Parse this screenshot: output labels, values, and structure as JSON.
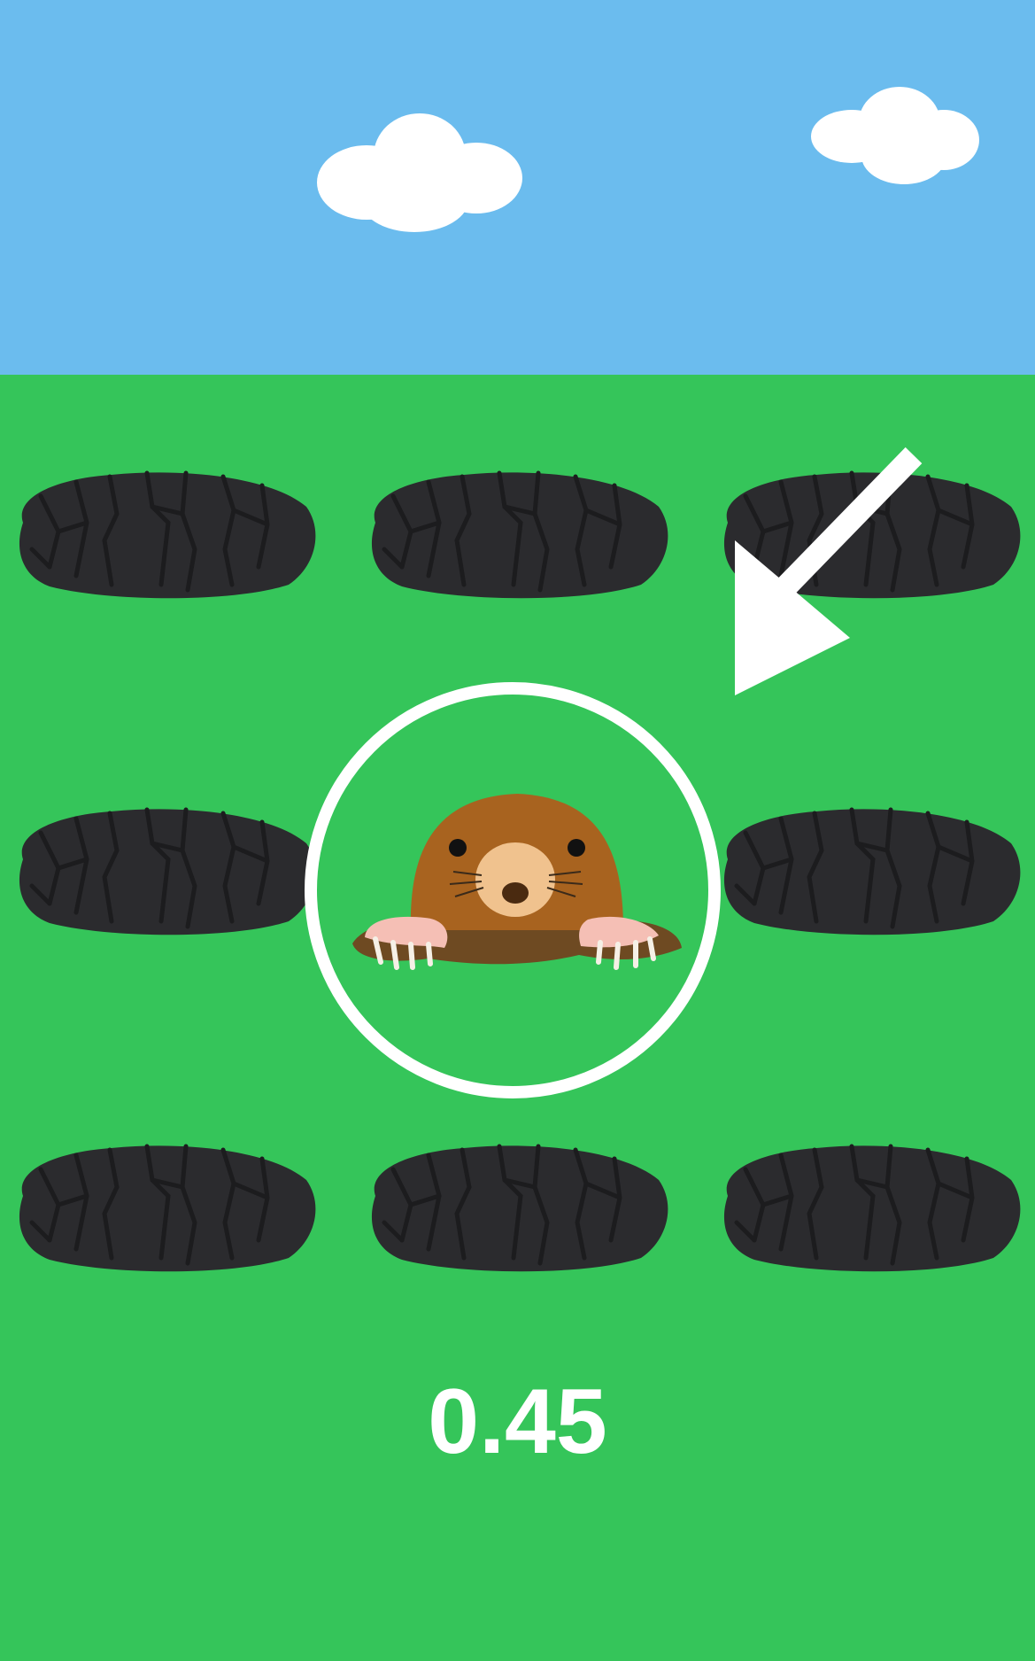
{
  "game": {
    "timer_value": "0.45",
    "grid": {
      "rows": 3,
      "cols": 3,
      "active_hole": {
        "row": 2,
        "col": 2
      }
    }
  },
  "colors": {
    "sky": "#6bbcee",
    "ground": "#35c55a",
    "hole": "#2b2b2e",
    "hole_crack": "#1c1c1e",
    "cloud": "#ffffff",
    "ring": "#ffffff",
    "timer_text": "#ffffff",
    "mole_body": "#a8631f",
    "mole_snout": "#f0c28e",
    "mole_paw": "#f5bfb5",
    "dirt": "#6e4a22"
  },
  "icons": [
    "cloud-icon",
    "mole-hole-icon",
    "mole-icon",
    "pointer-arrow-icon"
  ]
}
